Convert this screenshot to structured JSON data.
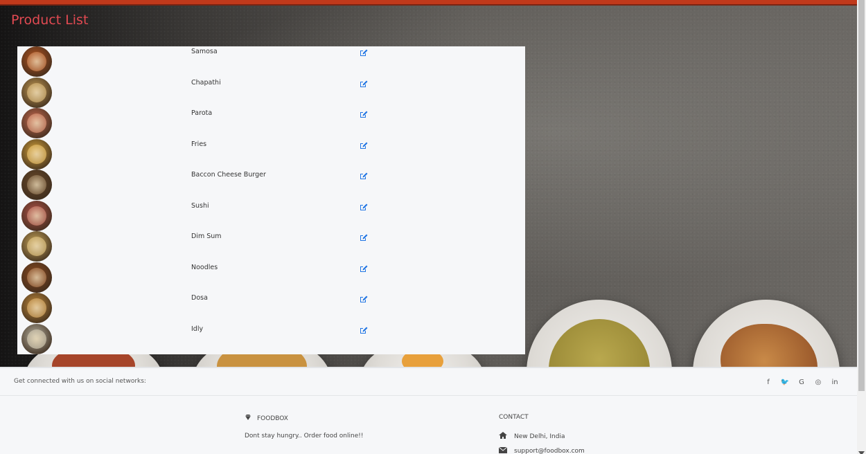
{
  "page": {
    "title": "Product List"
  },
  "products": [
    {
      "name": "Samosa",
      "color": "#b6541f"
    },
    {
      "name": "Chapathi",
      "color": "#c39a52"
    },
    {
      "name": "Parota",
      "color": "#c86a4f"
    },
    {
      "name": "Fries",
      "color": "#d7a43a"
    },
    {
      "name": "Baccon Cheese Burger",
      "color": "#6a4a2a"
    },
    {
      "name": "Sushi",
      "color": "#b35348"
    },
    {
      "name": "Dim Sum",
      "color": "#caa75a"
    },
    {
      "name": "Noodles",
      "color": "#8c4a20"
    },
    {
      "name": "Dosa",
      "color": "#c28a3a"
    },
    {
      "name": "Idly",
      "color": "#b7b1a0"
    }
  ],
  "icons": {
    "edit": "edit-icon"
  },
  "social": {
    "text": "Get connected with us on social networks:",
    "networks": [
      {
        "id": "facebook",
        "glyph": "f"
      },
      {
        "id": "twitter",
        "glyph": "🐦"
      },
      {
        "id": "google",
        "glyph": "G"
      },
      {
        "id": "instagram",
        "glyph": "◎"
      },
      {
        "id": "linkedin",
        "glyph": "in"
      }
    ]
  },
  "footer": {
    "brand": "FOODBOX",
    "tagline": "Dont stay hungry.. Order food online!!",
    "contact_title": "CONTACT",
    "address": "New Delhi, India",
    "email": "support@foodbox.com"
  },
  "colors": {
    "accent": "#e24a52",
    "edit": "#1e74e4",
    "top_border": "#c0391b"
  }
}
